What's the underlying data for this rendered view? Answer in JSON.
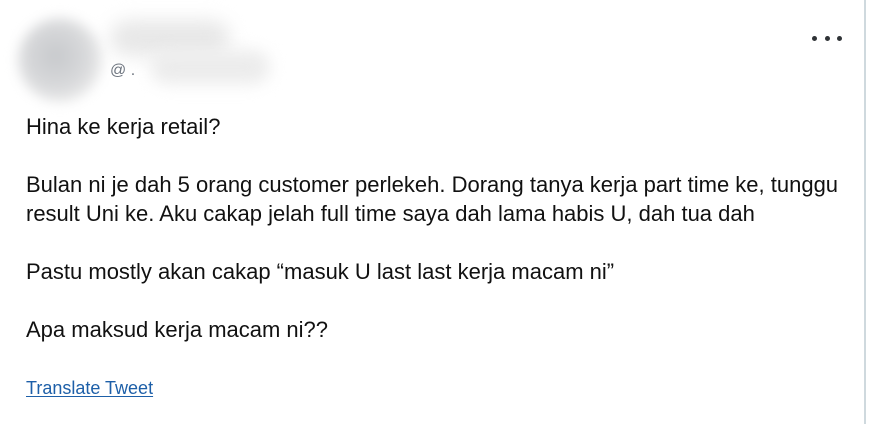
{
  "tweet": {
    "handle": "@ .",
    "lines": {
      "first": "Hina ke kerja retail?",
      "second": "Bulan ni je dah 5 orang customer perlekeh. Dorang tanya kerja part time ke, tunggu result Uni ke. Aku cakap jelah full time saya dah lama habis U, dah tua dah",
      "third": "Pastu mostly akan cakap “masuk U last last kerja macam ni”",
      "fourth": "Apa maksud kerja macam ni??"
    },
    "translate_label": "Translate Tweet",
    "more_icon": "more-horizontal-icon"
  }
}
